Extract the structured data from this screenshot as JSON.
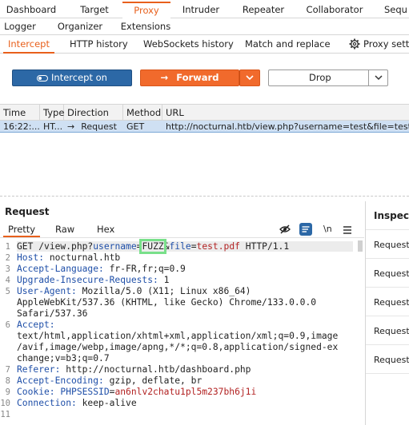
{
  "top_tabs_row1": [
    "Dashboard",
    "Target",
    "Proxy",
    "Intruder",
    "Repeater",
    "Collaborator",
    "Sequ"
  ],
  "top_tabs_row2": [
    "Logger",
    "Organizer",
    "Extensions"
  ],
  "proxy_tabs": [
    "Intercept",
    "HTTP history",
    "WebSockets history",
    "Match and replace",
    "Proxy settin"
  ],
  "buttons": {
    "intercept": "Intercept on",
    "forward": "Forward",
    "drop": "Drop"
  },
  "table": {
    "headers": [
      "Time",
      "Type",
      "Direction",
      "Method",
      "URL"
    ],
    "row": {
      "time": "16:22:...",
      "type": "HT...",
      "direction": "Request",
      "method": "GET",
      "url": "http://nocturnal.htb/view.php?username=test&file=test.pdf"
    }
  },
  "request": {
    "title": "Request",
    "tabs": [
      "Pretty",
      "Raw",
      "Hex"
    ],
    "newline_toggle": "\\n",
    "lines": {
      "l1": {
        "method": "GET ",
        "path": "/view.php?",
        "p1": "username",
        "eq1": "=",
        "fuzz": "FUZZ",
        "amp": "&",
        "p2": "file",
        "eq2": "=",
        "v2": "test.pdf",
        "proto": " HTTP/1.1"
      },
      "l2": {
        "k": "Host:",
        "v": " nocturnal.htb"
      },
      "l3": {
        "k": "Accept-Language:",
        "v": " fr-FR,fr;q=0.9"
      },
      "l4": {
        "k": "Upgrade-Insecure-Requests:",
        "v": " 1"
      },
      "l5a": {
        "k": "User-Agent:",
        "v": " Mozilla/5.0 (X11; Linux x86_64)"
      },
      "l5b": "AppleWebKit/537.36 (KHTML, like Gecko) Chrome/133.0.0.0",
      "l5c": "Safari/537.36",
      "l6a": {
        "k": "Accept:"
      },
      "l6b": "text/html,application/xhtml+xml,application/xml;q=0.9,image",
      "l6c": "/avif,image/webp,image/apng,*/*;q=0.8,application/signed-ex",
      "l6d": "change;v=b3;q=0.7",
      "l7": {
        "k": "Referer:",
        "v": " http://nocturnal.htb/dashboard.php"
      },
      "l8": {
        "k": "Accept-Encoding:",
        "v": " gzip, deflate, br"
      },
      "l9": {
        "k": "Cookie:",
        "c": " PHPSESSID",
        "eq": "=",
        "v": "an6nlv2chatu1pl5m237bh6j1i"
      },
      "l10": {
        "k": "Connection:",
        "v": " keep-alive"
      }
    },
    "line_numbers": [
      "1",
      "2",
      "3",
      "4",
      "5",
      "6",
      "7",
      "8",
      "9",
      "10",
      "11"
    ]
  },
  "inspector": {
    "title": "Inspect",
    "items": [
      "Request a",
      "Request c",
      "Request b",
      "Request c",
      "Request b"
    ]
  },
  "colors": {
    "accent": "#e8601c",
    "intercept_button": "#2c68a6",
    "forward_button": "#f16a2c",
    "fuzz_highlight": "#79e08a"
  }
}
